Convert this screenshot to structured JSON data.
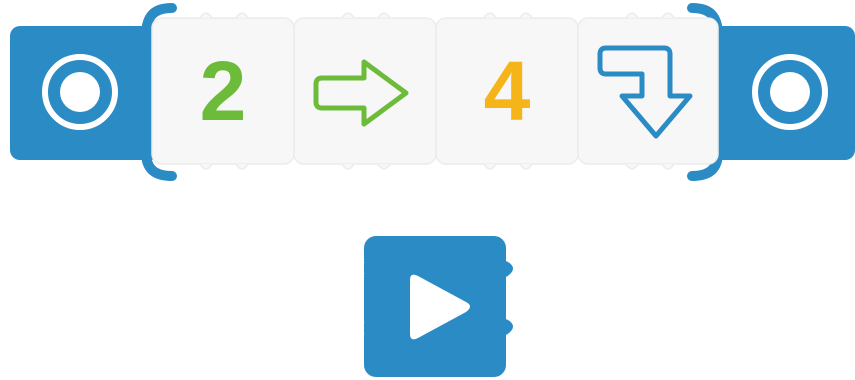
{
  "sequence": {
    "tiles": [
      {
        "kind": "number",
        "text": "2",
        "color": "#6dbb3a"
      },
      {
        "kind": "arrow",
        "icon": "arrow-right-icon",
        "color": "#6dbb3a"
      },
      {
        "kind": "number",
        "text": "4",
        "color": "#f5b417"
      },
      {
        "kind": "arrow",
        "icon": "arrow-turn-down-icon",
        "color": "#2b8bc4"
      }
    ],
    "start_icon": "circle-target-icon",
    "end_icon": "circle-target-icon"
  },
  "controls": {
    "play_icon": "play-icon"
  },
  "colors": {
    "brand_blue": "#2b8bc4",
    "tile_bg": "#f7f7f7",
    "tile_edge": "#ececec",
    "icon_white": "#ffffff"
  }
}
